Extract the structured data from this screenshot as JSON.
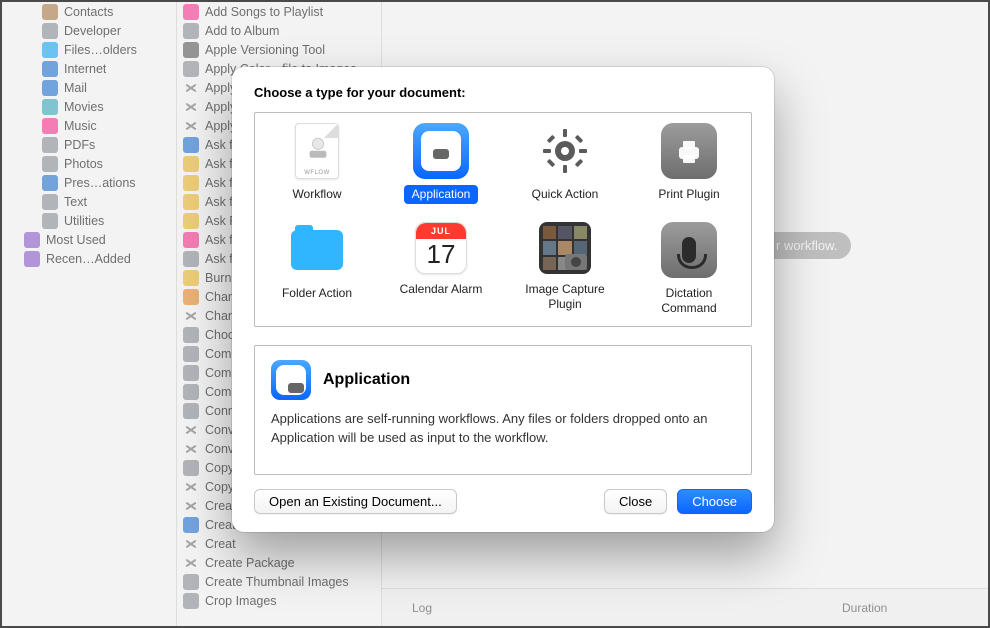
{
  "sidebar": {
    "items": [
      {
        "label": "Contacts",
        "icon": "contacts-icon",
        "color": "c-brown"
      },
      {
        "label": "Developer",
        "icon": "developer-icon",
        "color": "c-gray"
      },
      {
        "label": "Files…olders",
        "icon": "files-folders-icon",
        "color": "c-cyan"
      },
      {
        "label": "Internet",
        "icon": "internet-icon",
        "color": "c-blue"
      },
      {
        "label": "Mail",
        "icon": "mail-icon",
        "color": "c-blue"
      },
      {
        "label": "Movies",
        "icon": "movies-icon",
        "color": "c-teal"
      },
      {
        "label": "Music",
        "icon": "music-icon",
        "color": "c-pink"
      },
      {
        "label": "PDFs",
        "icon": "pdfs-icon",
        "color": "c-gray"
      },
      {
        "label": "Photos",
        "icon": "photos-icon",
        "color": "c-gray"
      },
      {
        "label": "Pres…ations",
        "icon": "presentations-icon",
        "color": "c-blue"
      },
      {
        "label": "Text",
        "icon": "text-icon",
        "color": "c-gray"
      },
      {
        "label": "Utilities",
        "icon": "utilities-icon",
        "color": "c-gray"
      }
    ],
    "groups": [
      {
        "label": "Most Used",
        "icon": "folder-icon",
        "color": "c-purple"
      },
      {
        "label": "Recen…Added",
        "icon": "folder-icon",
        "color": "c-purple"
      }
    ]
  },
  "actions": {
    "items": [
      {
        "label": "Add Songs to Playlist",
        "color": "c-pink"
      },
      {
        "label": "Add to Album",
        "color": "c-gray"
      },
      {
        "label": "Apple Versioning Tool",
        "color": "c-dgray"
      },
      {
        "label": "Apply Color…file to Images",
        "color": "c-gray"
      },
      {
        "label": "Apply",
        "color": "c-gray",
        "cross": true
      },
      {
        "label": "Apply",
        "color": "c-gray",
        "cross": true
      },
      {
        "label": "Apply",
        "color": "c-gray",
        "cross": true
      },
      {
        "label": "Ask f",
        "color": "c-blue"
      },
      {
        "label": "Ask f",
        "color": "c-yellow"
      },
      {
        "label": "Ask f",
        "color": "c-yellow"
      },
      {
        "label": "Ask f",
        "color": "c-yellow"
      },
      {
        "label": "Ask F",
        "color": "c-yellow"
      },
      {
        "label": "Ask f",
        "color": "c-pink"
      },
      {
        "label": "Ask f",
        "color": "c-gray"
      },
      {
        "label": "Burn",
        "color": "c-yellow"
      },
      {
        "label": "Chan",
        "color": "c-orange"
      },
      {
        "label": "Chan",
        "color": "c-gray",
        "cross": true
      },
      {
        "label": "Choo",
        "color": "c-gray"
      },
      {
        "label": "Comb",
        "color": "c-gray"
      },
      {
        "label": "Comb",
        "color": "c-gray"
      },
      {
        "label": "Comp",
        "color": "c-gray"
      },
      {
        "label": "Conn",
        "color": "c-gray"
      },
      {
        "label": "Conv",
        "color": "c-gray",
        "cross": true
      },
      {
        "label": "Conv",
        "color": "c-gray",
        "cross": true
      },
      {
        "label": "Copy",
        "color": "c-gray"
      },
      {
        "label": "Copy",
        "color": "c-gray",
        "cross": true
      },
      {
        "label": "Creat",
        "color": "c-gray",
        "cross": true
      },
      {
        "label": "Creat",
        "color": "c-blue"
      },
      {
        "label": "Creat",
        "color": "c-gray",
        "cross": true
      },
      {
        "label": "Create Package",
        "color": "c-gray",
        "cross": true
      },
      {
        "label": "Create Thumbnail Images",
        "color": "c-gray"
      },
      {
        "label": "Crop Images",
        "color": "c-gray"
      }
    ]
  },
  "main": {
    "placeholder_hint": "r workflow.",
    "log_label": "Log",
    "duration_label": "Duration"
  },
  "modal": {
    "title": "Choose a type for your document:",
    "types": [
      {
        "label": "Workflow"
      },
      {
        "label": "Application",
        "selected": true
      },
      {
        "label": "Quick Action"
      },
      {
        "label": "Print Plugin"
      },
      {
        "label": "Folder Action"
      },
      {
        "label": "Calendar Alarm"
      },
      {
        "label": "Image Capture Plugin"
      },
      {
        "label": "Dictation Command"
      }
    ],
    "calendar": {
      "month": "JUL",
      "day": "17"
    },
    "workflow_tag": "WFLOW",
    "description": {
      "title": "Application",
      "text": "Applications are self-running workflows. Any files or folders dropped onto an Application will be used as input to the workflow."
    },
    "buttons": {
      "open_existing": "Open an Existing Document...",
      "close": "Close",
      "choose": "Choose"
    }
  }
}
